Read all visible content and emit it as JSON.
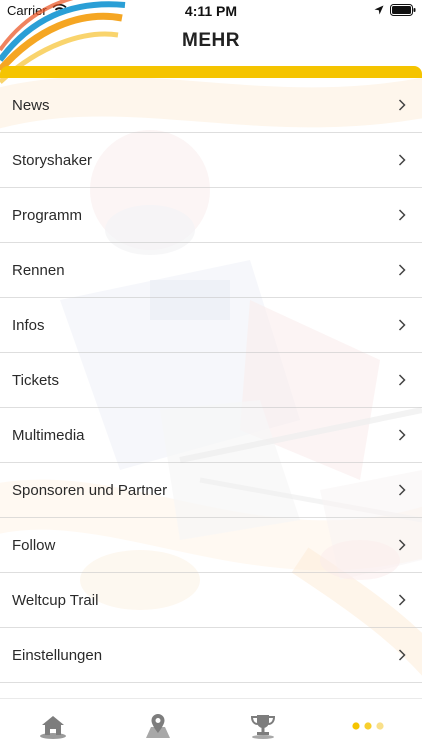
{
  "status_bar": {
    "carrier": "Carrier",
    "time": "4:11 PM"
  },
  "header": {
    "title": "MEHR"
  },
  "menu": {
    "items": [
      {
        "label": "News"
      },
      {
        "label": "Storyshaker"
      },
      {
        "label": "Programm"
      },
      {
        "label": "Rennen"
      },
      {
        "label": "Infos"
      },
      {
        "label": "Tickets"
      },
      {
        "label": "Multimedia"
      },
      {
        "label": "Sponsoren und Partner"
      },
      {
        "label": "Follow"
      },
      {
        "label": "Weltcup Trail"
      },
      {
        "label": "Einstellungen"
      }
    ]
  },
  "tab_bar": {
    "tabs": [
      {
        "icon": "home-icon",
        "active": false
      },
      {
        "icon": "map-pin-icon",
        "active": false
      },
      {
        "icon": "trophy-icon",
        "active": false
      },
      {
        "icon": "more-dots-icon",
        "active": true
      }
    ]
  },
  "colors": {
    "accent": "#f5c400",
    "tab_inactive": "#8a8a8a",
    "text": "#2a2a2a"
  }
}
